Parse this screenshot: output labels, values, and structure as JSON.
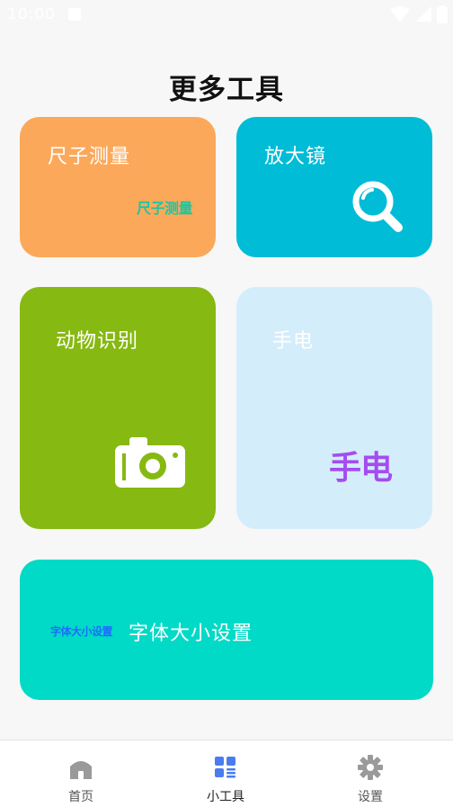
{
  "status_bar": {
    "time": "10:00"
  },
  "page": {
    "title": "更多工具"
  },
  "cards": {
    "ruler": {
      "label": "尺子测量",
      "logo_text": "尺子测量"
    },
    "magnifier": {
      "label": "放大镜"
    },
    "animal": {
      "label": "动物识别"
    },
    "flashlight": {
      "label": "手电",
      "logo_text": "手电"
    },
    "font_size": {
      "label": "字体大小设置",
      "logo_text": "字体大小设置"
    }
  },
  "nav": {
    "items": [
      {
        "label": "首页",
        "icon": "home-icon"
      },
      {
        "label": "小工具",
        "icon": "tools-icon",
        "active": true
      },
      {
        "label": "设置",
        "icon": "gear-icon"
      }
    ]
  },
  "colors": {
    "ruler": "#fca85a",
    "magnifier": "#00bcd6",
    "animal": "#86b911",
    "flashlight": "#d4edfb",
    "font_size": "#00dac6",
    "active_nav": "#4a7cf0",
    "inactive_nav": "#9a9a9a"
  }
}
